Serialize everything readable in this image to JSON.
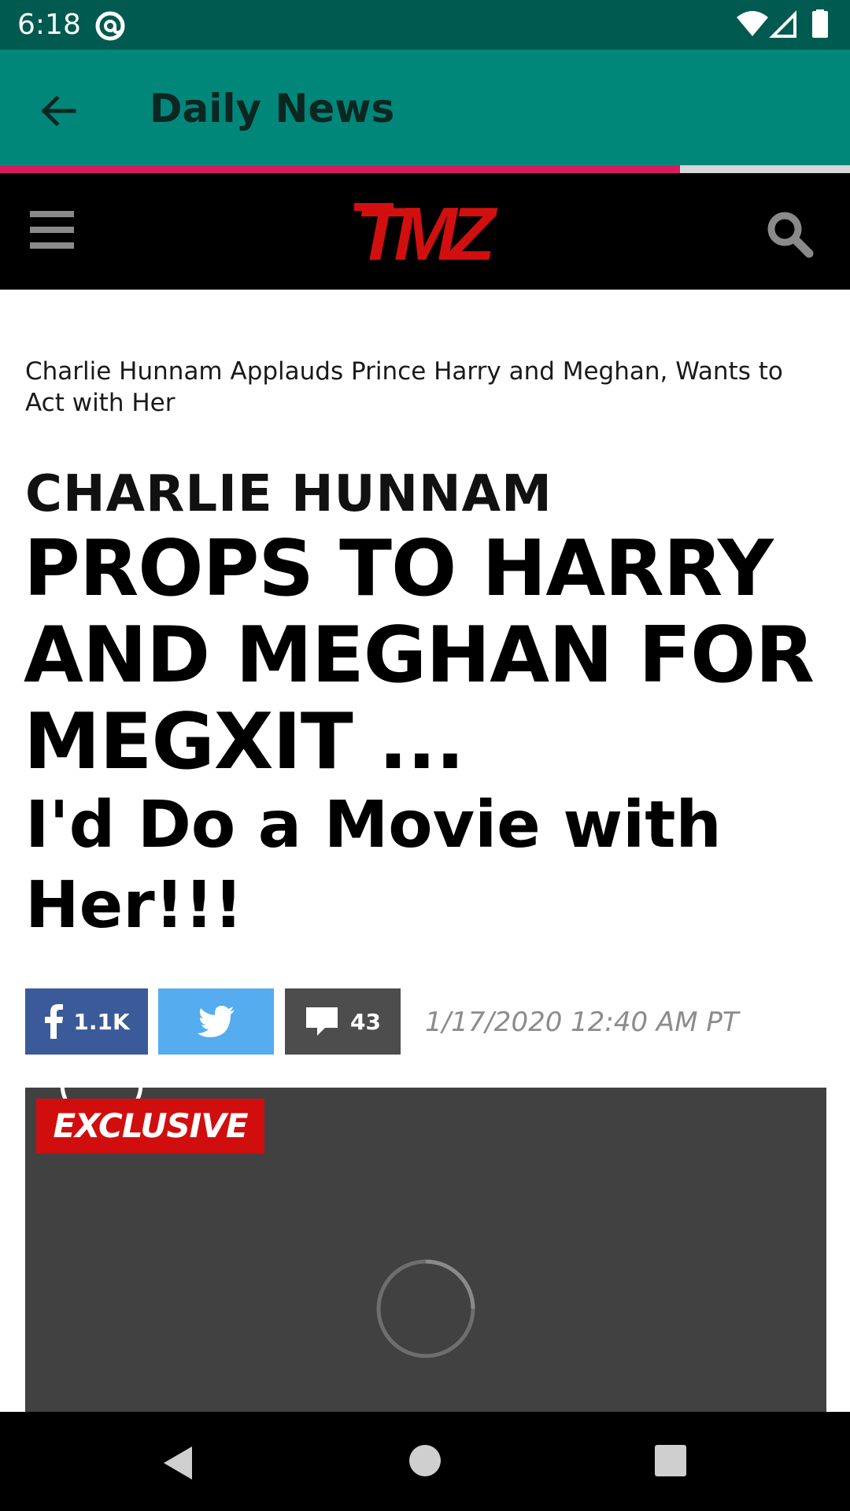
{
  "status_bar": {
    "time": "6:18",
    "app_icon": "at-sign-icon",
    "icons": [
      "wifi-icon",
      "cell-signal-icon",
      "battery-icon"
    ]
  },
  "app_bar": {
    "title": "Daily News",
    "back_icon": "arrow-back-icon",
    "background": "#00877a"
  },
  "load_progress": {
    "fraction": 0.8,
    "color": "#d81b60"
  },
  "site_header": {
    "logo_text": "TMZ",
    "menu_icon": "hamburger-menu-icon",
    "search_icon": "search-icon"
  },
  "article": {
    "kicker": "Charlie Hunnam Applauds Prince Harry and Meghan, Wants to Act with Her",
    "headline_name": "CHARLIE HUNNAM",
    "headline_main": "PROPS TO HARRY AND MEGHAN FOR MEGXIT ...",
    "headline_sub": "I'd Do a Movie with Her!!!",
    "share": {
      "facebook_count": "1.1K",
      "comments_count": "43",
      "facebook_icon": "facebook-icon",
      "twitter_icon": "twitter-icon",
      "comment_icon": "comment-icon"
    },
    "timestamp": "1/17/2020 12:40 AM PT",
    "video": {
      "badge": "EXCLUSIVE",
      "loading_icon": "loading-spinner-icon"
    }
  },
  "nav_bar": {
    "icons": [
      "nav-back-icon",
      "nav-home-icon",
      "nav-recents-icon"
    ]
  }
}
